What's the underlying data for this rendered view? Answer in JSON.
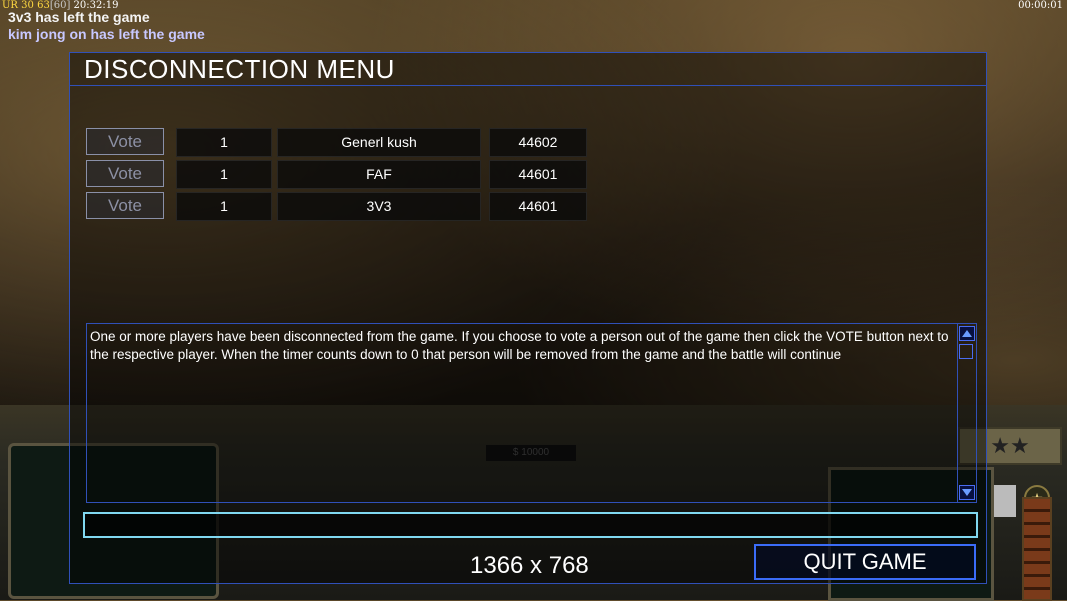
{
  "hud": {
    "ur_label": "UR",
    "stat1": "30",
    "stat2": "63",
    "stat3": "[60]",
    "clock": "20:32:19",
    "timer": "00:00:01"
  },
  "messages": [
    "3v3 has left the game",
    "kim jong on has left the game"
  ],
  "gamebar": {
    "money": "$ 10000",
    "rank": "★★"
  },
  "dialog": {
    "title": "DISCONNECTION MENU",
    "vote_label": "Vote",
    "players": [
      {
        "slot": "1",
        "name": "Generl kush",
        "port": "44602"
      },
      {
        "slot": "1",
        "name": "FAF",
        "port": "44601"
      },
      {
        "slot": "1",
        "name": "3V3",
        "port": "44601"
      }
    ],
    "message": "One or more players have been disconnected from the game. If you choose to vote a person out of the game then click the VOTE button next to the respective player. When the timer counts down to 0 that person will be removed from the game and the battle will continue",
    "chat_value": "",
    "resolution": "1366 x 768",
    "quit_label": "QUIT GAME"
  },
  "colors": {
    "border": "#3050b8",
    "chat_border": "#80d8f0",
    "quit_border": "#3b6cf8",
    "ur_color": "#ffd940"
  }
}
